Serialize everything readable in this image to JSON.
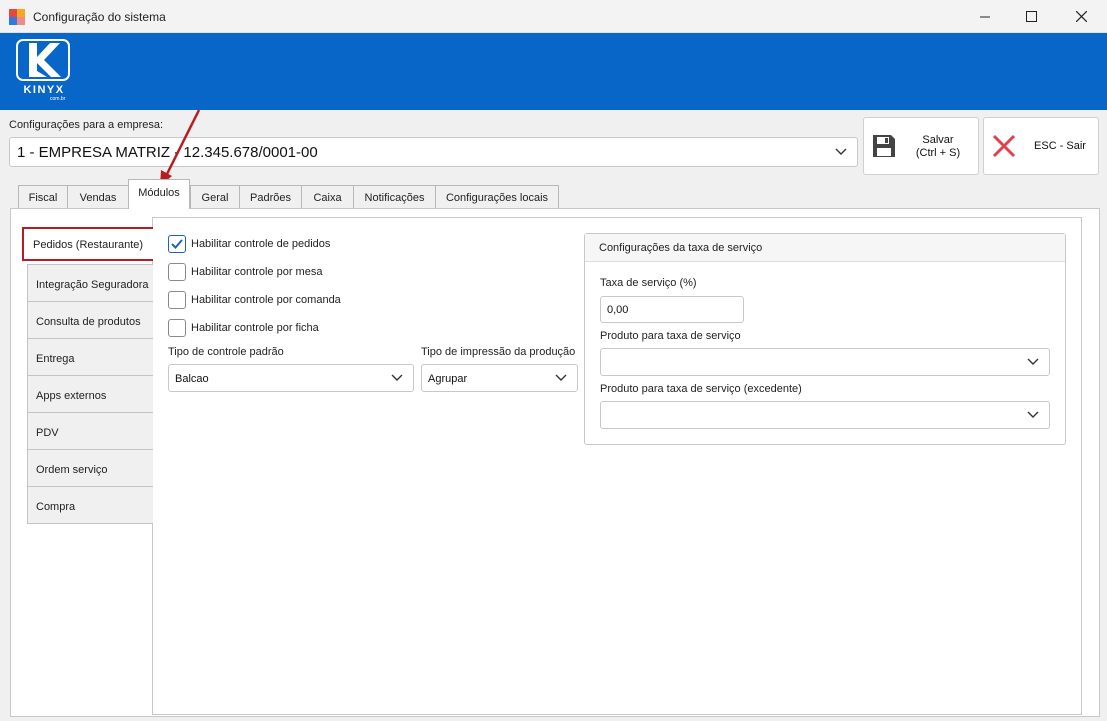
{
  "window": {
    "title": "Configuração do sistema",
    "minimize_glyph": "—",
    "maximize_glyph": "☐",
    "close_glyph": "✕"
  },
  "brand": {
    "name": "KINYX",
    "domain": "com.br"
  },
  "empresa": {
    "label": "Configurações para a empresa:",
    "selected": "1 - EMPRESA MATRIZ - 12.345.678/0001-00"
  },
  "actions": {
    "save_label_1": "Salvar",
    "save_label_2": "(Ctrl + S)",
    "exit_label": "ESC - Sair"
  },
  "tabs": [
    {
      "label": "Fiscal"
    },
    {
      "label": "Vendas"
    },
    {
      "label": "Módulos",
      "active": true
    },
    {
      "label": "Geral"
    },
    {
      "label": "Padrões"
    },
    {
      "label": "Caixa"
    },
    {
      "label": "Notificações"
    },
    {
      "label": "Configurações locais"
    }
  ],
  "sidetabs": [
    {
      "label": "Pedidos (Restaurante)",
      "active": true
    },
    {
      "label": "Integração Seguradora"
    },
    {
      "label": "Consulta de produtos"
    },
    {
      "label": "Entrega"
    },
    {
      "label": "Apps externos"
    },
    {
      "label": "PDV"
    },
    {
      "label": "Ordem serviço"
    },
    {
      "label": "Compra"
    }
  ],
  "pedidos": {
    "checkboxes": [
      {
        "label": "Habilitar controle de pedidos",
        "checked": true
      },
      {
        "label": "Habilitar controle por mesa",
        "checked": false
      },
      {
        "label": "Habilitar controle por comanda",
        "checked": false
      },
      {
        "label": "Habilitar controle por ficha",
        "checked": false
      }
    ],
    "tipo_controle": {
      "label": "Tipo de controle padrão",
      "value": "Balcao"
    },
    "tipo_impressao": {
      "label": "Tipo de impressão da produção",
      "value": "Agrupar"
    }
  },
  "taxa_servico": {
    "title": "Configurações da taxa de serviço",
    "taxa_label": "Taxa de serviço (%)",
    "taxa_value": "0,00",
    "produto_label": "Produto para taxa de serviço",
    "produto_value": "",
    "produto_excedente_label": "Produto para taxa de serviço (excedente)",
    "produto_excedente_value": ""
  },
  "colors": {
    "banner": "#0866c9",
    "highlight": "#b81c22",
    "accent": "#1f63b8",
    "exit_icon": "#e0414b"
  }
}
